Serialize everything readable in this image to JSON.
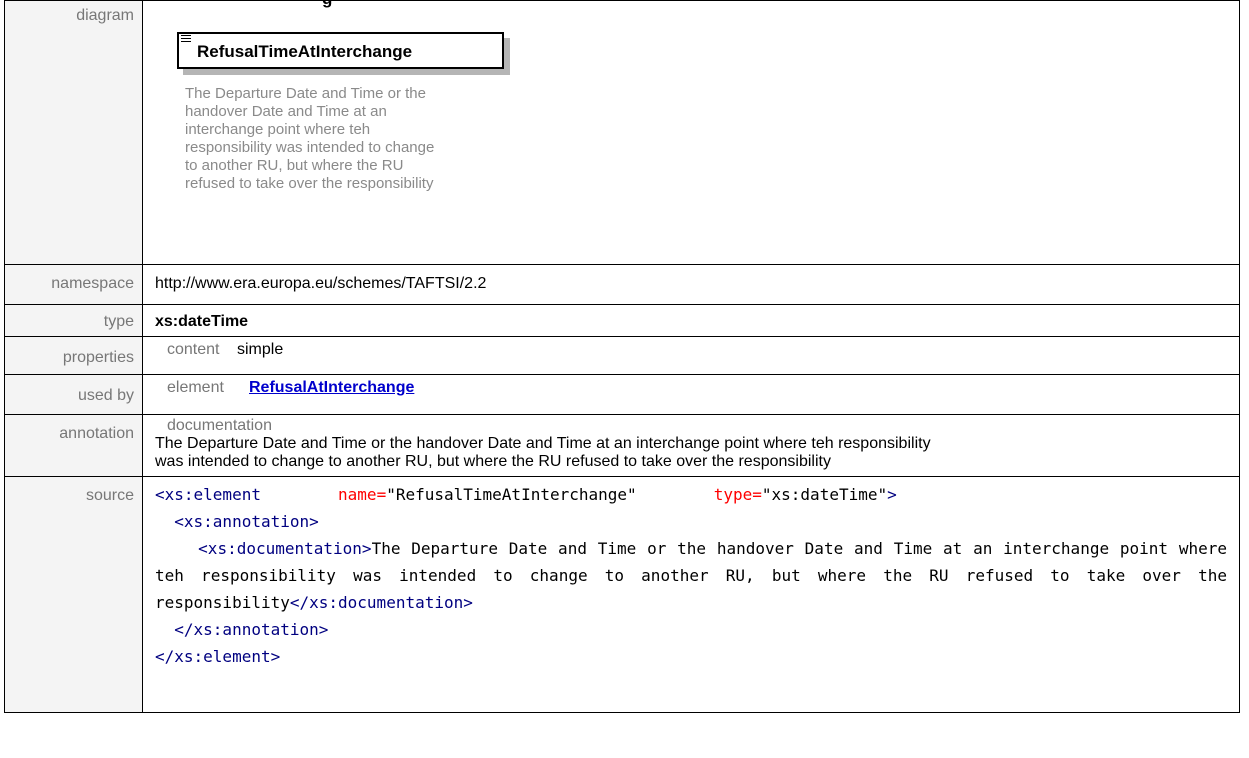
{
  "heading_fragment": "g",
  "diagram": {
    "label": "diagram",
    "element_name": "RefusalTimeAtInterchange",
    "doc_lines": [
      "The Departure Date and Time or the",
      "handover Date and Time at an",
      "interchange point where teh",
      "responsibility was intended to change",
      "to another RU, but where the RU",
      "refused to take over the responsibility"
    ]
  },
  "namespace": {
    "label": "namespace",
    "value": "http://www.era.europa.eu/schemes/TAFTSI/2.2"
  },
  "type": {
    "label": "type",
    "value": "xs:dateTime"
  },
  "properties": {
    "label": "properties",
    "key": "content",
    "value": "simple"
  },
  "used_by": {
    "label": "used by",
    "key": "element",
    "value": "RefusalAtInterchange"
  },
  "annotation": {
    "label": "annotation",
    "key": "documentation",
    "text_line1": "The Departure Date and Time or the handover Date and Time at an interchange point where teh responsibility",
    "text_line2": "was intended to change to another RU, but where the RU refused to take over the responsibility"
  },
  "source": {
    "label": "source",
    "open_element": "<xs:element",
    "attr_name": "name=",
    "attr_name_value": "\"RefusalTimeAtInterchange\"",
    "attr_type": "type=",
    "attr_type_value": "\"xs:dateTime\"",
    "open_close": ">",
    "annotation_open": "<xs:annotation>",
    "documentation_open": "<xs:documentation>",
    "documentation_text": "The Departure Date and Time or the handover Date and Time at an interchange point where teh responsibility was intended to change to another RU, but where the RU refused to take over the responsibility",
    "documentation_close": "</xs:documentation>",
    "annotation_close": "</xs:annotation>",
    "element_close": "</xs:element>"
  }
}
